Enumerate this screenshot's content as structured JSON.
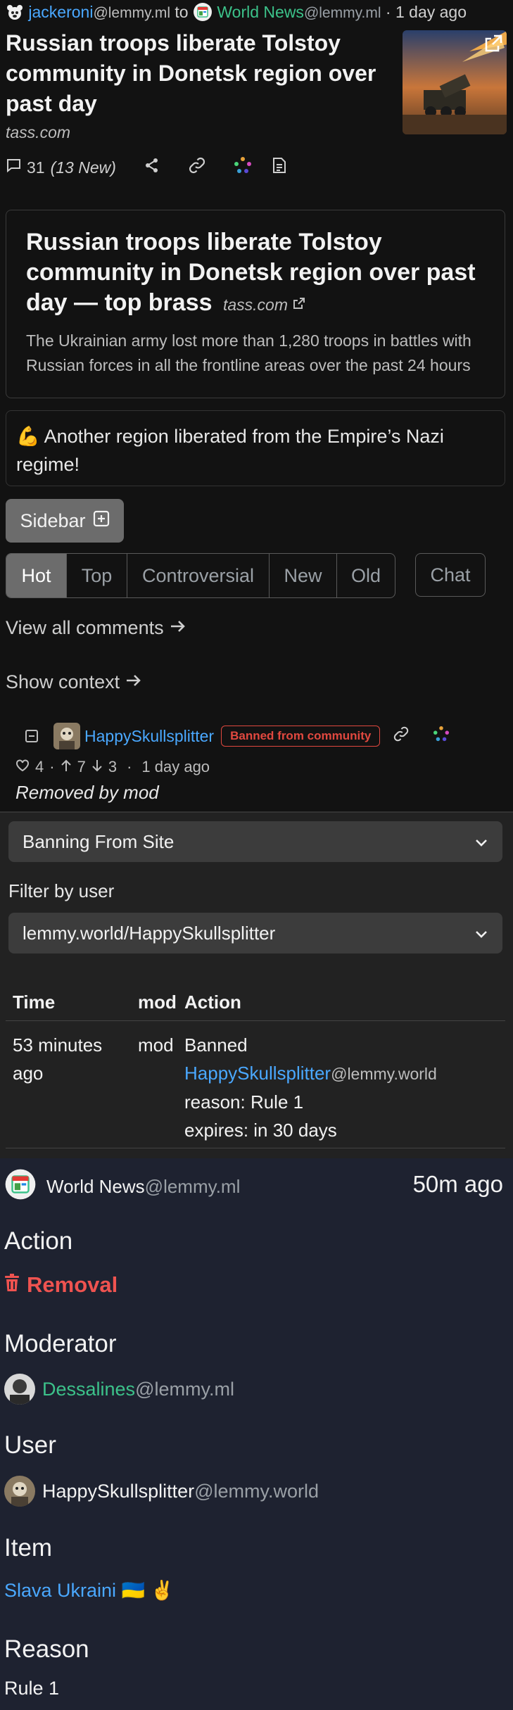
{
  "post": {
    "author_name": "jackeroni",
    "author_instance": "@lemmy.ml",
    "to_word": "to",
    "community_name": "World News",
    "community_instance": "@lemmy.ml",
    "time": "· 1 day ago",
    "title": "Russian troops liberate Tolstoy community in Donetsk region over past day",
    "domain": "tass.com",
    "comments_count": "31",
    "comments_new": "(13 New)"
  },
  "card": {
    "title": "Russian troops liberate Tolstoy community in Donetsk region over past day — top brass",
    "domain": "tass.com",
    "description": "The Ukrainian army lost more than 1,280 troops in battles with Russian forces in all the frontline areas over the past 24 hours"
  },
  "body_text": "💪 Another region liberated from the Empire’s Nazi regime!",
  "sidebar_label": "Sidebar",
  "sort_tabs": [
    "Hot",
    "Top",
    "Controversial",
    "New",
    "Old"
  ],
  "active_sort": "Hot",
  "chat_label": "Chat",
  "view_all_comments": "View all comments",
  "show_context": "Show context",
  "comment": {
    "author": "HappySkullsplitter",
    "badge": "Banned from community",
    "likes": "4",
    "upvotes": "7",
    "downvotes": "3",
    "time": "1 day ago",
    "removed_text": "Removed by mod"
  },
  "modlog": {
    "action_select": "Banning From Site",
    "filter_label": "Filter by user",
    "user_select": "lemmy.world/HappySkullsplitter",
    "table": {
      "headers": [
        "Time",
        "mod",
        "Action"
      ],
      "row": {
        "time": "53 minutes ago",
        "mod": "mod",
        "action_line1": "Banned",
        "action_user": "HappySkullsplitter",
        "action_user_instance": "@lemmy.world",
        "reason": "reason: Rule 1",
        "expires": "expires: in 30 days"
      }
    }
  },
  "modcard": {
    "community_name": "World News",
    "community_instance": "@lemmy.ml",
    "time": "50m ago",
    "action_heading": "Action",
    "action_value": "Removal",
    "moderator_heading": "Moderator",
    "moderator_name": "Dessalines",
    "moderator_instance": "@lemmy.ml",
    "user_heading": "User",
    "user_name": "HappySkullsplitter",
    "user_instance": "@lemmy.world",
    "item_heading": "Item",
    "item_value": "Slava Ukraini 🇺🇦 ✌️",
    "reason_heading": "Reason",
    "reason_value": "Rule 1"
  },
  "colors": {
    "link_blue": "#4aa8ff",
    "green": "#3cc28a",
    "banned_red": "#e0483f",
    "removal_red": "#ef5350"
  }
}
